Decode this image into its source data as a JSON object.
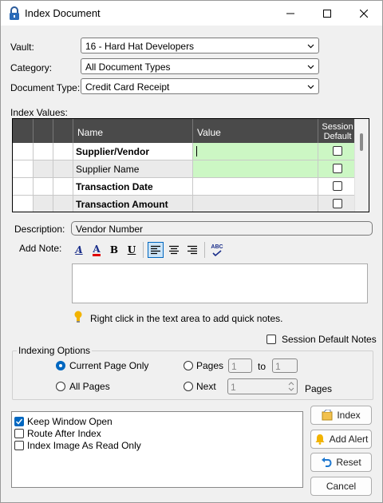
{
  "window": {
    "title": "Index Document"
  },
  "form": {
    "vault": {
      "label": "Vault:",
      "value": "16 - Hard Hat Developers"
    },
    "category": {
      "label": "Category:",
      "value": "All Document Types"
    },
    "document_type": {
      "label": "Document Type:",
      "value": "Credit Card Receipt"
    }
  },
  "index_values": {
    "label": "Index Values:",
    "columns": {
      "name": "Name",
      "value": "Value",
      "session_default": "Session Default"
    },
    "rows": [
      {
        "name": "Supplier/Vendor",
        "bold": true,
        "highlight": true,
        "value": ""
      },
      {
        "name": "Supplier Name",
        "bold": false,
        "highlight": true,
        "value": ""
      },
      {
        "name": "Transaction Date",
        "bold": true,
        "highlight": false,
        "value": ""
      },
      {
        "name": "Transaction Amount",
        "bold": true,
        "highlight": false,
        "value": ""
      }
    ]
  },
  "description": {
    "label": "Description:",
    "value": "Vendor Number"
  },
  "note": {
    "label": "Add Note:",
    "value": "",
    "hint": "Right click in the text area to add quick notes.",
    "toolbar": {
      "font": "A",
      "color": "A",
      "bold": "B",
      "underline": "U",
      "spell": "ABC"
    }
  },
  "session_default_notes": {
    "label": "Session Default Notes",
    "checked": false
  },
  "indexing_options": {
    "label": "Indexing Options",
    "current_page_only": "Current Page Only",
    "all_pages": "All Pages",
    "pages": "Pages",
    "pages_from": "1",
    "to": "to",
    "pages_to": "1",
    "next": "Next",
    "next_value": "1",
    "pages_suffix": "Pages",
    "selected": "Current Page Only"
  },
  "options_list": [
    {
      "label": "Keep Window Open",
      "checked": true
    },
    {
      "label": "Route After Index",
      "checked": false
    },
    {
      "label": "Index Image As Read Only",
      "checked": false
    }
  ],
  "buttons": {
    "index": "Index",
    "add_alert": "Add Alert",
    "reset": "Reset",
    "cancel": "Cancel"
  },
  "colors": {
    "accent": "#0067c0",
    "grid_header": "#4a4a4a",
    "highlight": "#ccf7c4",
    "alert_yellow": "#f2b300"
  }
}
